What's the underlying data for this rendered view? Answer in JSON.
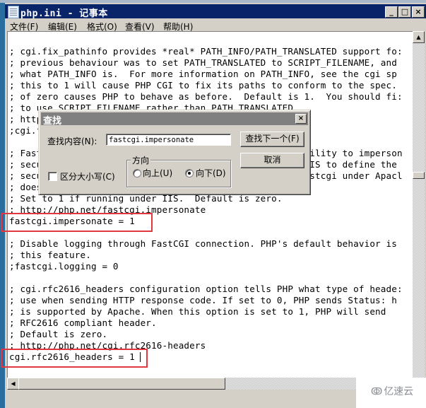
{
  "window": {
    "title": "php.ini - 记事本",
    "controls": {
      "minimize": "_",
      "maximize": "□",
      "close": "×"
    }
  },
  "menu": [
    "文件(F)",
    "编辑(E)",
    "格式(O)",
    "查看(V)",
    "帮助(H)"
  ],
  "editor": {
    "lines": [
      "",
      "; cgi.fix_pathinfo provides *real* PATH_INFO/PATH_TRANSLATED support fo:",
      "; previous behaviour was to set PATH_TRANSLATED to SCRIPT_FILENAME, and",
      "; what PATH_INFO is.  For more information on PATH_INFO, see the cgi sp",
      "; this to 1 will cause PHP CGI to fix its paths to conform to the spec.",
      "; of zero causes PHP to behave as before.  Default is 1.  You should fi:",
      "; to use SCRIPT_FILENAME rather than PATH_TRANSLATED.",
      "; http://php.net/cgi.fix-pathinfo",
      ";cgi.fix_pathinfo=1",
      "",
      "; FastCGI under IIS (on WINNT based OS) supports the ability to imperson",
      "; security tokens of the calling client.  This allows IIS to define the",
      "; security context that the request runs under.  mod_fastcgi under Apacl",
      "; does not currently support this feature (03/17/2002)",
      "; Set to 1 if running under IIS.  Default is zero.",
      "; http://php.net/fastcgi.impersonate",
      "fastcgi.impersonate = 1",
      "",
      "; Disable logging through FastCGI connection. PHP's default behavior is",
      "; this feature.",
      ";fastcgi.logging = 0",
      "",
      "; cgi.rfc2616_headers configuration option tells PHP what type of heade:",
      "; use when sending HTTP response code. If set to 0, PHP sends Status: h",
      "; is supported by Apache. When this option is set to 1, PHP will send",
      "; RFC2616 compliant header.",
      "; Default is zero.",
      "; http://php.net/cgi.rfc2616-headers",
      "cgi.rfc2616_headers = 1",
      "",
      ";;;;;;;;;;;;;;;;"
    ]
  },
  "find_dialog": {
    "title": "查找",
    "find_label": "查找内容(N):",
    "find_value": "fastcgi.impersonate",
    "find_next_button": "查找下一个(F)",
    "cancel_button": "取消",
    "direction_label": "方向",
    "direction_up": "向上(U)",
    "direction_down": "向下(D)",
    "direction_selected": "down",
    "match_case_label": "区分大小写(C)",
    "match_case_checked": false,
    "close": "×"
  },
  "highlights": {
    "color": "#e0383e",
    "targets": [
      "fastcgi.impersonate = 1",
      "cgi.rfc2616_headers = 1"
    ]
  },
  "watermark": {
    "logo": "ↂ",
    "text": "亿速云"
  }
}
